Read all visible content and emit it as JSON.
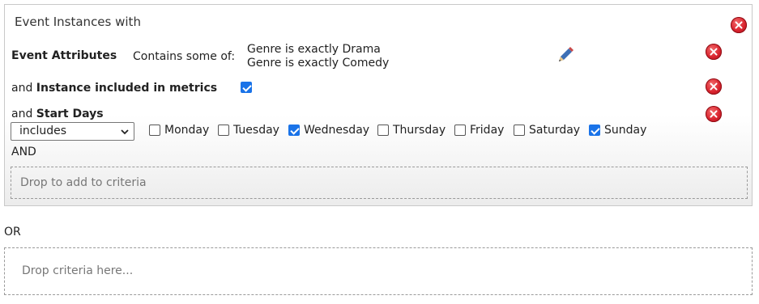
{
  "group": {
    "title": "Event Instances with",
    "event_attributes": {
      "label": "Event Attributes",
      "operator": "Contains some of:",
      "values": [
        "Genre is exactly Drama",
        "Genre is exactly Comedy"
      ]
    },
    "instance_metrics": {
      "prefix": "and",
      "label": "Instance included in metrics",
      "checked": true
    },
    "start_days": {
      "prefix": "and",
      "label": "Start Days",
      "mode": "includes",
      "days": [
        {
          "label": "Monday",
          "checked": false
        },
        {
          "label": "Tuesday",
          "checked": false
        },
        {
          "label": "Wednesday",
          "checked": true
        },
        {
          "label": "Thursday",
          "checked": false
        },
        {
          "label": "Friday",
          "checked": false
        },
        {
          "label": "Saturday",
          "checked": false
        },
        {
          "label": "Sunday",
          "checked": true
        }
      ]
    },
    "and_label": "AND",
    "inner_dropzone": "Drop to add to criteria"
  },
  "or_label": "OR",
  "outer_dropzone": "Drop criteria here...",
  "colors": {
    "accent": "#1a73e8",
    "remove": "#d9232e"
  },
  "icons": {
    "remove": "close-icon",
    "edit": "pencil-icon",
    "dropdown": "chevron-down-icon"
  }
}
